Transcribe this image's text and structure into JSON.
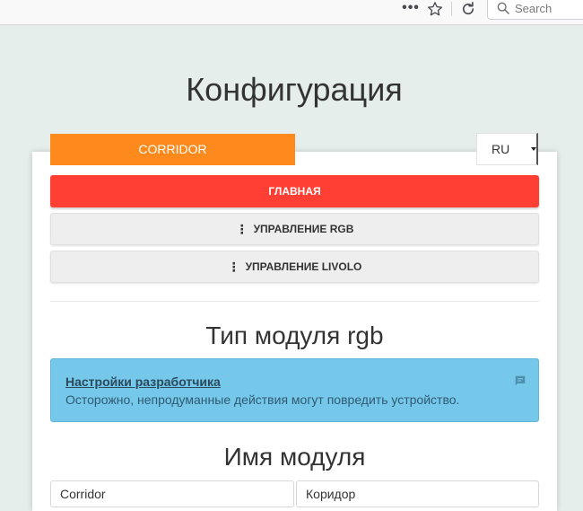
{
  "browser": {
    "search_placeholder": "Search"
  },
  "page": {
    "title": "Конфигурация"
  },
  "device_tab": {
    "label": "CORRIDOR"
  },
  "language": {
    "selected": "RU"
  },
  "nav": {
    "main": "ГЛАВНАЯ",
    "rgb": "УПРАВЛЕНИЕ RGB",
    "livolo": "УПРАВЛЕНИЕ LIVOLO"
  },
  "sections": {
    "module_type_title": "Тип модуля rgb",
    "module_name_title": "Имя модуля"
  },
  "alert": {
    "link": "Настройки разработчика",
    "text": "Осторожно, непродуманные действия могут повредить устройство."
  },
  "fields": {
    "first_value": "Corridor",
    "second_value": "Коридор"
  },
  "colors": {
    "device_tab": "#fe8a1e",
    "main_button": "#ff3f34",
    "alert_bg": "#76c8ea",
    "page_bg": "#e6eeec"
  },
  "icons": {
    "meatball": "meatball-menu-icon",
    "bookmark": "star-icon",
    "reload": "reload-icon",
    "search": "search-icon",
    "alert": "chat-icon",
    "kebab": "kebab-icon"
  }
}
